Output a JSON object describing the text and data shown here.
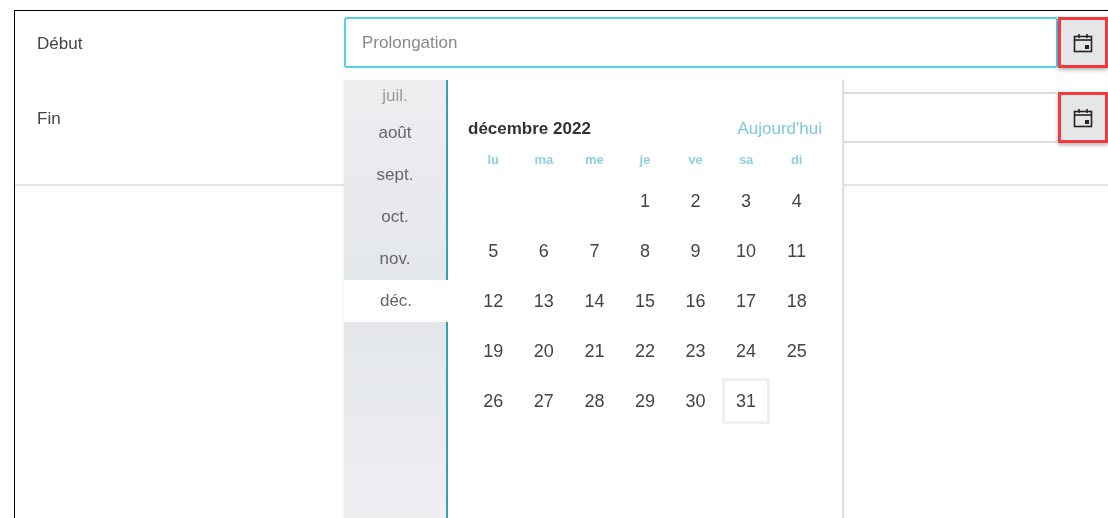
{
  "fields": [
    {
      "label": "Début",
      "placeholder": "Prolongation",
      "focused": true,
      "button_highlighted": true
    },
    {
      "label": "Fin",
      "focused": false,
      "button_highlighted": true
    }
  ],
  "datepicker": {
    "months": [
      {
        "label": "juil.",
        "selected": false,
        "faded": true
      },
      {
        "label": "août",
        "selected": false,
        "faded": false
      },
      {
        "label": "sept.",
        "selected": false,
        "faded": false
      },
      {
        "label": "oct.",
        "selected": false,
        "faded": false
      },
      {
        "label": "nov.",
        "selected": false,
        "faded": false
      },
      {
        "label": "déc.",
        "selected": true,
        "faded": false
      }
    ],
    "title": "décembre 2022",
    "today_link": "Aujourd'hui",
    "weekdays": [
      "lu",
      "ma",
      "me",
      "je",
      "ve",
      "sa",
      "di"
    ],
    "weeks": [
      [
        {
          "label": "1",
          "today": false
        },
        {
          "label": "2",
          "today": false
        },
        {
          "label": "3",
          "today": false
        },
        {
          "label": "4",
          "today": false
        }
      ],
      [
        {
          "label": "5",
          "today": false
        },
        {
          "label": "6",
          "today": false
        },
        {
          "label": "7",
          "today": false
        },
        {
          "label": "8",
          "today": false
        },
        {
          "label": "9",
          "today": false
        },
        {
          "label": "10",
          "today": false
        },
        {
          "label": "11",
          "today": false
        }
      ],
      [
        {
          "label": "12",
          "today": false
        },
        {
          "label": "13",
          "today": false
        },
        {
          "label": "14",
          "today": false
        },
        {
          "label": "15",
          "today": false
        },
        {
          "label": "16",
          "today": false
        },
        {
          "label": "17",
          "today": false
        },
        {
          "label": "18",
          "today": false
        }
      ],
      [
        {
          "label": "19",
          "today": false
        },
        {
          "label": "20",
          "today": false
        },
        {
          "label": "21",
          "today": false
        },
        {
          "label": "22",
          "today": false
        },
        {
          "label": "23",
          "today": false
        },
        {
          "label": "24",
          "today": false
        },
        {
          "label": "25",
          "today": false
        }
      ],
      [
        {
          "label": "26",
          "today": false
        },
        {
          "label": "27",
          "today": false
        },
        {
          "label": "28",
          "today": false
        },
        {
          "label": "29",
          "today": false
        },
        {
          "label": "30",
          "today": false
        },
        {
          "label": "31",
          "today": true
        }
      ]
    ]
  }
}
